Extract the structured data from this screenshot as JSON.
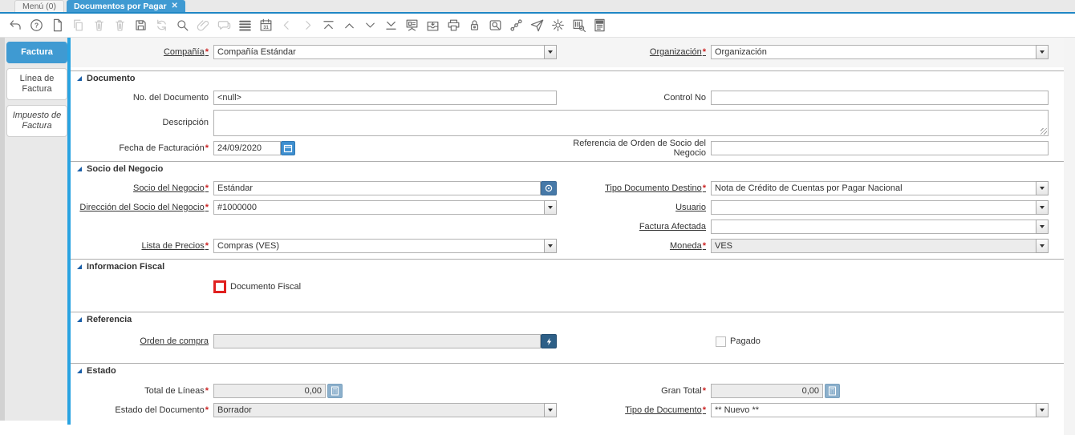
{
  "tabs": {
    "menu": "Menú (0)",
    "active": "Documentos por Pagar",
    "close_glyph": "✕"
  },
  "toolbar": {
    "help_glyph": "?",
    "calendar_day": "31",
    "icons": [
      "undo",
      "help",
      "new-record",
      "copy-record",
      "delete-record",
      "delete-selection",
      "save",
      "refresh",
      "find",
      "attachment",
      "chat",
      "grid-toggle",
      "calendar",
      "previous-page",
      "next-page",
      "first-record",
      "previous-record",
      "next-record",
      "last-record",
      "detail-record",
      "archive",
      "print",
      "lock",
      "zoom-across",
      "workflow",
      "send-mail",
      "preferences",
      "product-info",
      "report"
    ]
  },
  "sidebar": {
    "tab1": "Factura",
    "tab2": "Línea de Factura",
    "tab3": "Impuesto de Factura"
  },
  "sections": {
    "documento": "Documento",
    "socio": "Socio del Negocio",
    "fiscal": "Informacion Fiscal",
    "referencia": "Referencia",
    "estado": "Estado"
  },
  "marks": {
    "required": "*"
  },
  "fields": {
    "compania": {
      "label": "Compañía",
      "value": "Compañía Estándar",
      "required": true
    },
    "organizacion": {
      "label": "Organización",
      "value": "Organización",
      "required": true
    },
    "no_documento": {
      "label": "No. del Documento",
      "value": "<null>"
    },
    "control_no": {
      "label": "Control No",
      "value": ""
    },
    "descripcion": {
      "label": "Descripción",
      "value": ""
    },
    "fecha_facturacion": {
      "label": "Fecha de Facturación",
      "value": "24/09/2020",
      "required": true
    },
    "referencia_orden": {
      "label": "Referencia de Orden de Socio del Negocio",
      "value": ""
    },
    "socio_negocio": {
      "label": "Socio del Negocio",
      "value": "Estándar",
      "required": true
    },
    "tipo_doc_destino": {
      "label": "Tipo Documento Destino",
      "value": "Nota de Crédito de Cuentas por Pagar Nacional",
      "required": true
    },
    "direccion_socio": {
      "label": "Dirección del Socio del Negocio",
      "value": "#1000000",
      "required": true
    },
    "usuario": {
      "label": "Usuario",
      "value": ""
    },
    "factura_afectada": {
      "label": "Factura Afectada",
      "value": ""
    },
    "lista_precios": {
      "label": "Lista de Precios",
      "value": "Compras (VES)",
      "required": true
    },
    "moneda": {
      "label": "Moneda",
      "value": "VES",
      "required": true
    },
    "documento_fiscal": {
      "label": "Documento Fiscal",
      "checked": false
    },
    "orden_compra": {
      "label": "Orden de compra",
      "value": ""
    },
    "pagado": {
      "label": "Pagado",
      "checked": false
    },
    "total_lineas": {
      "label": "Total de Líneas",
      "value": "0,00",
      "required": true
    },
    "gran_total": {
      "label": "Gran Total",
      "value": "0,00",
      "required": true
    },
    "estado_documento": {
      "label": "Estado del Documento",
      "value": "Borrador",
      "required": true
    },
    "tipo_documento": {
      "label": "Tipo de Documento",
      "value": "** Nuevo **",
      "required": true
    }
  },
  "colors": {
    "accent_blue": "#3f9ad2",
    "tab_underline": "#1f87c5",
    "sidebar_strip": "#29a3e1",
    "required_red": "#cc2222",
    "highlight_red": "#e0201f",
    "record_button": "#4679a8",
    "po_button": "#2d5f87",
    "calendar_button": "#3e8fd0",
    "calc_button": "#8cb0cc"
  }
}
